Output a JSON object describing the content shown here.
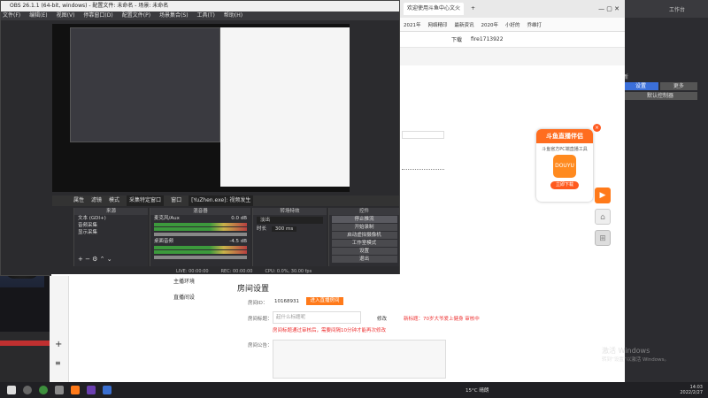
{
  "obs": {
    "title": "OBS 26.1.1 (64-bit, windows) - 配置文件: 未命名 - 场景: 未命名",
    "menu": [
      "文件(F)",
      "编辑(E)",
      "视图(V)",
      "停靠窗口(D)",
      "配置文件(P)",
      "场景集合(S)",
      "工具(T)",
      "帮助(H)"
    ],
    "toolbar": {
      "properties": "属性",
      "filters": "滤镜",
      "mode_label": "模式",
      "mode_value": "采集特定窗口",
      "window_label": "窗口",
      "window_value": "[YuZhen.exe]: 视频发生"
    },
    "docks": {
      "sources": "来源",
      "mixer": "混音器",
      "transitions": "转场特效",
      "controls": "控件"
    },
    "sources": [
      "文本 (GDI+)",
      "音频采集",
      "显示采集"
    ],
    "mixer": [
      {
        "name": "麦克风/Aux",
        "level": "0.0 dB"
      },
      {
        "name": "桌面音频",
        "level": "-4.5 dB"
      }
    ],
    "transition": {
      "type": "淡出",
      "duration_label": "时长",
      "duration": "300 ms"
    },
    "controls": [
      "停止推流",
      "开始录制",
      "启动虚拟摄像机",
      "工作室模式",
      "设置",
      "退出"
    ],
    "status": {
      "live": "LIVE: 00:00:00",
      "rec": "REC: 00:00:00",
      "cpu": "CPU: 0.0%, 30.00 fps"
    }
  },
  "browser": {
    "tabs": [
      "欢迎使用斗鱼中心文火",
      "+"
    ],
    "bookmarks": [
      "2021年",
      "网络精印",
      "最新资讯",
      "2020年",
      "小好的",
      "乔维打"
    ],
    "sub": [
      "下载",
      "fire1713922"
    ]
  },
  "promo": {
    "title": "斗鱼直播伴侣",
    "desc": "斗鱼官方PC端直播工具",
    "logo": "DOUYU",
    "download": "立即下载",
    "close": "×"
  },
  "room": {
    "nav": [
      "主播环境",
      "直播间设"
    ],
    "title": "房间设置",
    "room_id_label": "房间ID：",
    "room_id": "10168931",
    "enter_btn": "进入直播房间",
    "room_title_label": "房间标题：",
    "room_title_placeholder": "起什么标题呢",
    "change": "修改",
    "hint": "新标题：70岁大爷爱上健身 审核中",
    "warning": "房间标题通过审核后，需要间隔10分钟才能再次修改",
    "notice_label": "房间公告："
  },
  "taskbar": {
    "temp": "15°C 晴朗",
    "time": "14:03",
    "date": "2022/2/27"
  },
  "watermark": {
    "line1": "激活 Windows",
    "line2": "转到“设置”以激活 Windows。"
  },
  "right_app": {
    "header": "工作台",
    "items": [
      "新",
      "设置",
      "更多",
      "默认控制器"
    ]
  }
}
